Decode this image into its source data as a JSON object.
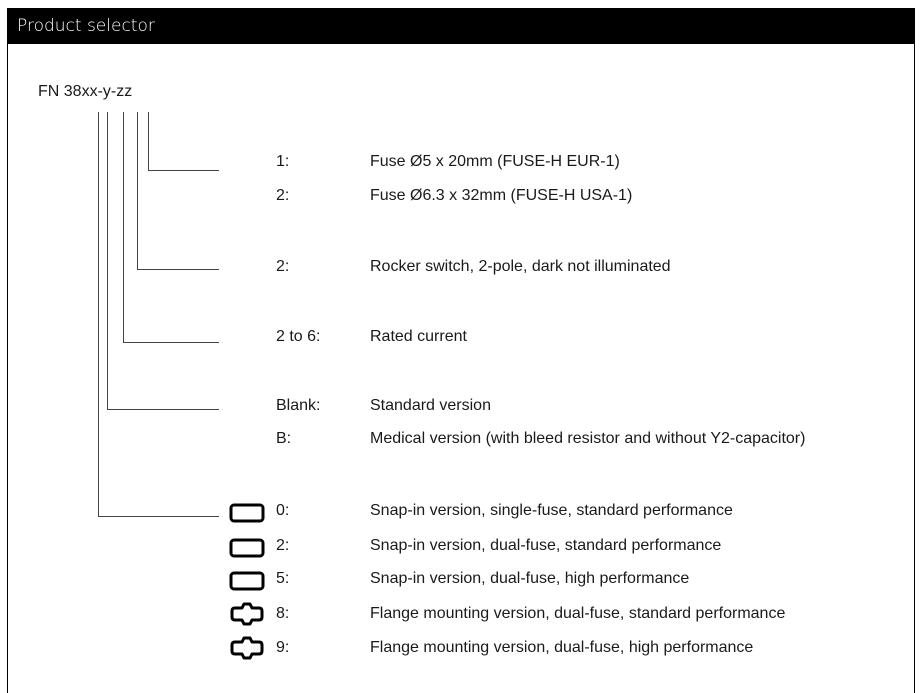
{
  "header": {
    "title": "Product selector"
  },
  "code": "FN 38xx-y-zz",
  "rows": [
    {
      "label": "1:",
      "desc": "Fuse Ø5 x 20mm (FUSE-H EUR-1)"
    },
    {
      "label": "2:",
      "desc": "Fuse Ø6.3 x 32mm (FUSE-H USA-1)"
    },
    {
      "label": "2:",
      "desc": "Rocker switch, 2-pole, dark not illuminated"
    },
    {
      "label": "2 to 6:",
      "desc": "Rated current"
    },
    {
      "label": "Blank:",
      "desc": "Standard version"
    },
    {
      "label": "B:",
      "desc": "Medical version (with bleed resistor and without Y2-capacitor)"
    },
    {
      "label": "0:",
      "desc": "Snap-in version, single-fuse, standard performance",
      "icon": "snap-in-icon"
    },
    {
      "label": "2:",
      "desc": "Snap-in version, dual-fuse, standard performance",
      "icon": "snap-in-icon"
    },
    {
      "label": "5:",
      "desc": "Snap-in version, dual-fuse, high performance",
      "icon": "snap-in-icon"
    },
    {
      "label": "8:",
      "desc": "Flange mounting version, dual-fuse, standard performance",
      "icon": "flange-icon"
    },
    {
      "label": "9:",
      "desc": "Flange mounting version, dual-fuse, high performance",
      "icon": "flange-icon"
    }
  ]
}
